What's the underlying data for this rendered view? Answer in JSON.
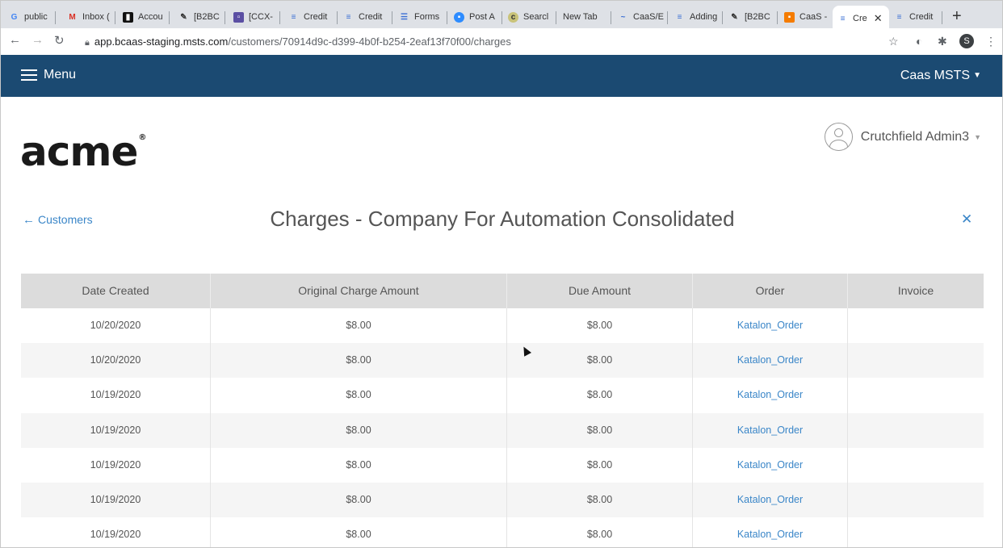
{
  "browser": {
    "tabs": [
      {
        "label": "public",
        "icon": "google-icon"
      },
      {
        "label": "Inbox (",
        "icon": "gmail-icon"
      },
      {
        "label": "Accou",
        "icon": "account-icon"
      },
      {
        "label": "[B2BC",
        "icon": "wrench-icon"
      },
      {
        "label": "[CCX-",
        "icon": "chat-icon"
      },
      {
        "label": "Credit",
        "icon": "doc-icon"
      },
      {
        "label": "Credit",
        "icon": "doc-icon"
      },
      {
        "label": "Forms",
        "icon": "list-icon"
      },
      {
        "label": "Post A",
        "icon": "post-icon"
      },
      {
        "label": "Searcl",
        "icon": "search-c-icon"
      },
      {
        "label": "New Tab",
        "icon": ""
      },
      {
        "label": "CaaS/E",
        "icon": "wave-icon"
      },
      {
        "label": "Adding",
        "icon": "doc-icon"
      },
      {
        "label": "[B2BC",
        "icon": "wrench-icon"
      },
      {
        "label": "CaaS -",
        "icon": "caas-icon"
      },
      {
        "label": "Cre",
        "icon": "doc-icon",
        "active": true
      },
      {
        "label": "Credit",
        "icon": "doc-icon"
      }
    ],
    "url_host": "app.bcaas-staging.msts.com",
    "url_path": "/customers/70914d9c-d399-4b0f-b254-2eaf13f70f00/charges",
    "profile_initial": "S"
  },
  "appbar": {
    "menu_label": "Menu",
    "tenant": "Caas MSTS"
  },
  "brand": {
    "logo": "acme",
    "logo_mark": "®"
  },
  "user": {
    "name": "Crutchfield Admin3"
  },
  "page": {
    "back_label": "Customers",
    "title": "Charges - Company For Automation Consolidated"
  },
  "table": {
    "headers": [
      "Date Created",
      "Original Charge Amount",
      "Due Amount",
      "Order",
      "Invoice"
    ],
    "rows": [
      [
        "10/20/2020",
        "$8.00",
        "$8.00",
        "Katalon_Order",
        ""
      ],
      [
        "10/20/2020",
        "$8.00",
        "$8.00",
        "Katalon_Order",
        ""
      ],
      [
        "10/19/2020",
        "$8.00",
        "$8.00",
        "Katalon_Order",
        ""
      ],
      [
        "10/19/2020",
        "$8.00",
        "$8.00",
        "Katalon_Order",
        ""
      ],
      [
        "10/19/2020",
        "$8.00",
        "$8.00",
        "Katalon_Order",
        ""
      ],
      [
        "10/19/2020",
        "$8.00",
        "$8.00",
        "Katalon_Order",
        ""
      ],
      [
        "10/19/2020",
        "$8.00",
        "$8.00",
        "Katalon_Order",
        ""
      ]
    ]
  },
  "colors": {
    "appbar_bg": "#1b4a72",
    "link": "#3a86c8",
    "table_header_bg": "#dcdcdc"
  }
}
